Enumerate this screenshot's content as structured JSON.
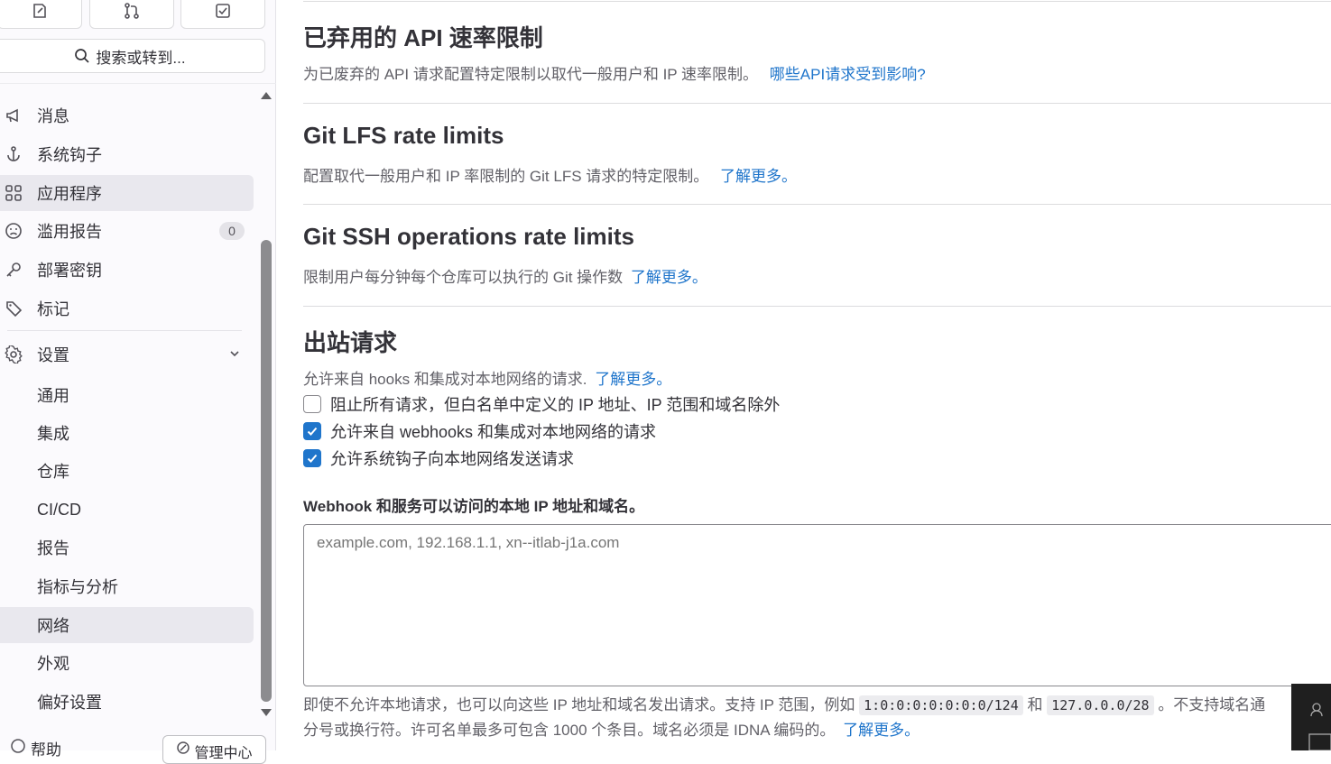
{
  "sidebar": {
    "top_icons": [
      "issues-icon",
      "merge-request-icon",
      "todo-icon"
    ],
    "search_label": "搜索或转到...",
    "items": [
      {
        "label": "消息",
        "icon": "megaphone-icon"
      },
      {
        "label": "系统钩子",
        "icon": "anchor-icon"
      },
      {
        "label": "应用程序",
        "icon": "applications-icon"
      },
      {
        "label": "滥用报告",
        "icon": "abuse-icon",
        "badge": "0"
      },
      {
        "label": "部署密钥",
        "icon": "key-icon"
      },
      {
        "label": "标记",
        "icon": "label-icon"
      }
    ],
    "settings": {
      "label": "设置",
      "sub_items": [
        "通用",
        "集成",
        "仓库",
        "CI/CD",
        "报告",
        "指标与分析",
        "网络",
        "外观",
        "偏好设置"
      ],
      "active": "网络"
    },
    "help_label": "帮助",
    "admin_label": "管理中心"
  },
  "main": {
    "deprecated_api": {
      "title": "已弃用的 API 速率限制",
      "desc": "为已废弃的 API 请求配置特定限制以取代一般用户和 IP 速率限制。",
      "link": "哪些API请求受到影响?"
    },
    "git_lfs": {
      "title": "Git LFS rate limits",
      "desc": "配置取代一般用户和 IP 率限制的 Git LFS 请求的特定限制。",
      "link": "了解更多。"
    },
    "git_ssh": {
      "title": "Git SSH operations rate limits",
      "desc": "限制用户每分钟每个仓库可以执行的 Git 操作数",
      "link": "了解更多。"
    },
    "outbound": {
      "title": "出站请求",
      "desc": "允许来自 hooks 和集成对本地网络的请求.",
      "link": "了解更多。",
      "checkboxes": [
        {
          "label": "阻止所有请求，但白名单中定义的 IP 地址、IP 范围和域名除外",
          "checked": false
        },
        {
          "label": "允许来自 webhooks 和集成对本地网络的请求",
          "checked": true
        },
        {
          "label": "允许系统钩子向本地网络发送请求",
          "checked": true
        }
      ],
      "field_label": "Webhook 和服务可以访问的本地 IP 地址和域名。",
      "field_placeholder": "example.com, 192.168.1.1, xn--itlab-j1a.com",
      "help_part1": "即使不允许本地请求，也可以向这些 IP 地址和域名发出请求。支持 IP 范围，例如",
      "code1": "1:0:0:0:0:0:0:0/124",
      "help_and": "和",
      "code2": "127.0.0.0/28",
      "help_part2": "。不支持域名通",
      "help_line2": "分号或换行符。许可名单最多可包含 1000 个条目。域名必须是 IDNA 编码的。",
      "help_link": "了解更多。"
    }
  },
  "colors": {
    "link": "#1f75cb",
    "checkbox_checked": "#1f75cb",
    "active_nav": "#e9e8ee"
  }
}
